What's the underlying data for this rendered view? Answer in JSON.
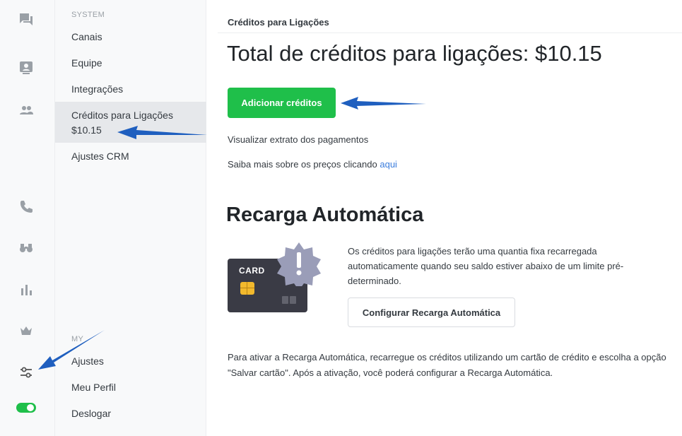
{
  "iconbar": {
    "icons": [
      "chat-icon",
      "contacts-card-icon",
      "team-icon",
      "phone-icon",
      "binoculars-icon",
      "bar-chart-icon",
      "crown-icon",
      "settings-sliders-icon",
      "status-toggle-icon"
    ]
  },
  "subnav": {
    "system_label": "SYSTEM",
    "system_items": [
      {
        "label": "Canais"
      },
      {
        "label": "Equipe"
      },
      {
        "label": "Integrações"
      },
      {
        "label": "Créditos para Ligações",
        "sub": "$10.15"
      },
      {
        "label": "Ajustes CRM"
      }
    ],
    "my_label": "MY",
    "my_items": [
      {
        "label": "Ajustes"
      },
      {
        "label": "Meu Perfil"
      },
      {
        "label": "Deslogar"
      }
    ]
  },
  "main": {
    "header": "Créditos para Ligações",
    "title": "Total de créditos para ligações: $10.15",
    "add_credits_button": "Adicionar créditos",
    "statement_link": "Visualizar extrato dos pagamentos",
    "pricing_text": "Saiba mais sobre os preços clicando",
    "pricing_link": "aqui",
    "auto_recharge": {
      "title": "Recarga Automática",
      "card_label": "CARD",
      "description": "Os créditos para ligações terão uma quantia fixa recarregada automaticamente quando seu saldo estiver abaixo de um limite pré-determinado.",
      "configure_button": "Configurar Recarga Automática",
      "note": "Para ativar a Recarga Automática, recarregue os créditos utilizando um cartão de crédito e escolha a opção \"Salvar cartão\". Após a ativação, você poderá configurar a Recarga Automática."
    }
  },
  "colors": {
    "primary_green": "#1fbf4a",
    "link_blue": "#3b7ddd",
    "annotation_arrow": "#1f5fbf",
    "card_dark": "#3a3b45",
    "badge_gray": "#9a9db8"
  }
}
